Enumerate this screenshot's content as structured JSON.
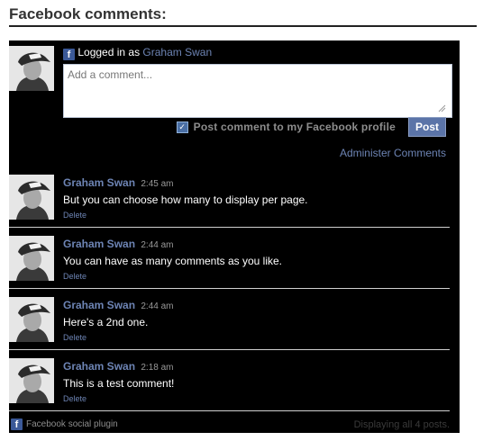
{
  "page": {
    "title": "Facebook comments:"
  },
  "composer": {
    "logged_in_prefix": "Logged in as",
    "user_name": "Graham Swan",
    "placeholder": "Add a comment...",
    "post_to_profile_label": "Post comment to my Facebook profile",
    "post_to_profile_checked": true,
    "post_button": "Post",
    "administer_link": "Administer Comments"
  },
  "comments": [
    {
      "author": "Graham Swan",
      "time": "2:45 am",
      "text": "But you can choose how many to display per page.",
      "delete_label": "Delete"
    },
    {
      "author": "Graham Swan",
      "time": "2:44 am",
      "text": "You can have as many comments as you like.",
      "delete_label": "Delete"
    },
    {
      "author": "Graham Swan",
      "time": "2:44 am",
      "text": "Here's a 2nd one.",
      "delete_label": "Delete"
    },
    {
      "author": "Graham Swan",
      "time": "2:18 am",
      "text": "This is a test comment!",
      "delete_label": "Delete"
    }
  ],
  "footer": {
    "plugin_label": "Facebook social plugin",
    "count_text": "Displaying all 4 posts."
  },
  "icons": {
    "facebook": "facebook-icon",
    "checkbox": "checkmark-icon",
    "avatar": "user-avatar"
  },
  "colors": {
    "link": "#6d84b4",
    "button": "#5b74a8",
    "widget_bg": "#000000"
  }
}
